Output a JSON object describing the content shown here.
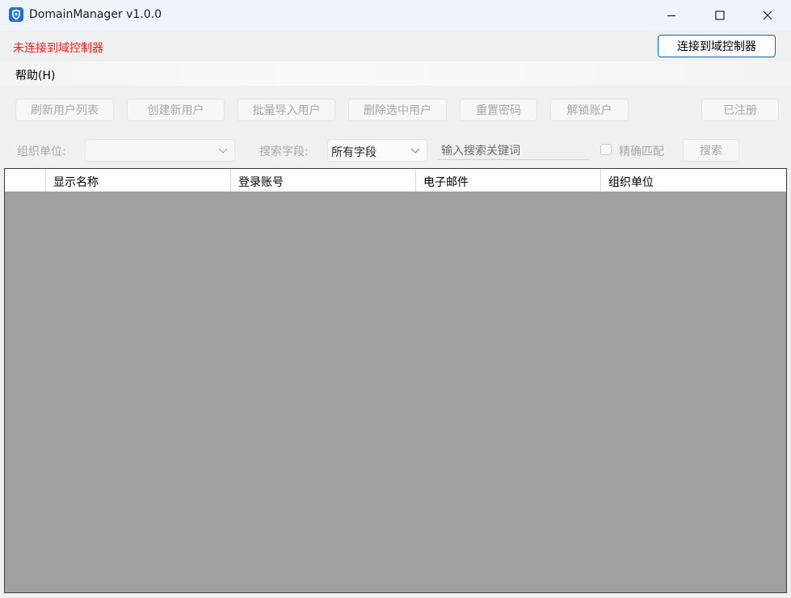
{
  "window": {
    "title": "DomainManager v1.0.0",
    "icon": "shield-icon",
    "controls": [
      "minimize-icon",
      "maximize-icon",
      "close-icon"
    ]
  },
  "status": {
    "text": "未连接到域控制器",
    "color": "#ff1a1a"
  },
  "connect_button": {
    "label": "连接到域控制器",
    "accent": "#0067c0"
  },
  "menu": {
    "help": "帮助(H)"
  },
  "toolbar": {
    "refresh": "刷新用户列表",
    "create": "创建新用户",
    "batch_import": "批量导入用户",
    "delete_selected": "删除选中用户",
    "reset_password": "重置密码",
    "unlock_account": "解锁账户",
    "registered": "已注册"
  },
  "filter": {
    "ou_label": "组织单位:",
    "ou_value": "",
    "field_label": "搜索字段:",
    "field_value": "所有字段",
    "search_value": "输入搜索关键词",
    "exact_match_label": "精确匹配",
    "exact_match_checked": false,
    "search_button": "搜索"
  },
  "table": {
    "columns": [
      "显示名称",
      "登录账号",
      "电子邮件",
      "组织单位"
    ],
    "rows": [],
    "empty_background": "#a0a0a0"
  }
}
